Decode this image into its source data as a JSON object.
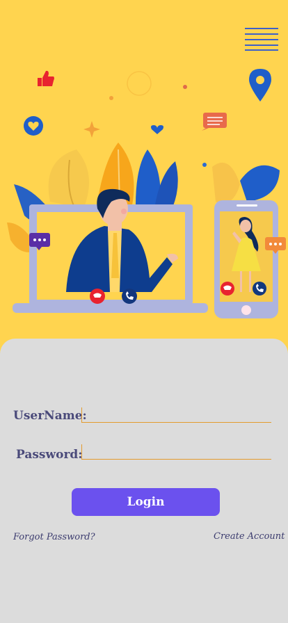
{
  "login_form": {
    "username_label": "UserName:",
    "username_value": "",
    "password_label": "Password:",
    "password_value": "",
    "login_button": "Login",
    "forgot_password": "Forgot Password?",
    "create_account": "Create Account"
  },
  "colors": {
    "hero_background": "#ffd44f",
    "sheet_background": "#dcdcdc",
    "accent": "#6b51ee",
    "field_underline": "#e49b2c",
    "menu_icon": "#3c5fc9"
  },
  "icons": [
    "menu-icon",
    "thumbs-up-icon",
    "heart-icon",
    "location-pin-icon",
    "chat-bubble-icon",
    "end-call-icon",
    "call-icon"
  ]
}
